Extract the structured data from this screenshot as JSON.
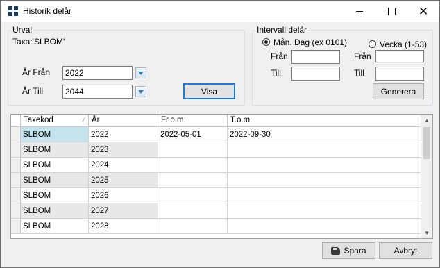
{
  "window": {
    "title": "Historik delår"
  },
  "urval": {
    "legend": "Urval",
    "taxa_text": "Taxa:'SLBOM'",
    "ar_fran_label": "År Från",
    "ar_fran_value": "2022",
    "ar_till_label": "År Till",
    "ar_till_value": "2044",
    "visa_label": "Visa"
  },
  "intervall": {
    "legend": "Intervall delår",
    "option_dag_label": "Mån. Dag (ex 0101)",
    "option_dag_selected": true,
    "option_vecka_label": "Vecka (1-53)",
    "option_vecka_selected": false,
    "fran_label_1": "Från",
    "till_label_1": "Till",
    "fran_label_2": "Från",
    "till_label_2": "Till",
    "fran_value_1": "",
    "till_value_1": "",
    "fran_value_2": "",
    "till_value_2": "",
    "generera_label": "Generera"
  },
  "grid": {
    "columns": [
      "Taxekod",
      "År",
      "Fr.o.m.",
      "T.o.m."
    ],
    "rows": [
      [
        "SLBOM",
        "2022",
        "2022-05-01",
        "2022-09-30"
      ],
      [
        "SLBOM",
        "2023",
        "",
        ""
      ],
      [
        "SLBOM",
        "2024",
        "",
        ""
      ],
      [
        "SLBOM",
        "2025",
        "",
        ""
      ],
      [
        "SLBOM",
        "2026",
        "",
        ""
      ],
      [
        "SLBOM",
        "2027",
        "",
        ""
      ],
      [
        "SLBOM",
        "2028",
        "",
        ""
      ]
    ]
  },
  "footer": {
    "spara_label": "Spara",
    "avbryt_label": "Avbryt"
  }
}
